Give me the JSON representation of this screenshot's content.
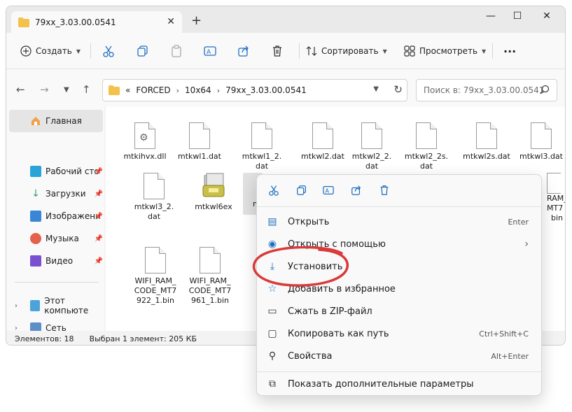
{
  "window": {
    "tab_title": "79xx_3.03.00.0541",
    "tab_close_glyph": "✕",
    "tab_add_glyph": "+",
    "minimize_glyph": "—",
    "maximize_glyph": "☐",
    "close_glyph": "✕"
  },
  "toolbar": {
    "create_label": "Создать",
    "sort_label": "Сортировать",
    "view_label": "Просмотреть",
    "more_glyph": "···"
  },
  "address": {
    "crumbs": [
      "FORCED",
      "10x64",
      "79xx_3.03.00.0541"
    ],
    "overflow_glyph": "«",
    "search_placeholder": "Поиск в: 79xx_3.03.00.0541"
  },
  "sidebar": {
    "items": [
      {
        "label": "Главная",
        "icon": "home-icon"
      },
      {
        "label": "Рабочий сто",
        "icon": "desktop-icon"
      },
      {
        "label": "Загрузки",
        "icon": "download-icon"
      },
      {
        "label": "Изображени",
        "icon": "pictures-icon"
      },
      {
        "label": "Музыка",
        "icon": "music-icon"
      },
      {
        "label": "Видео",
        "icon": "video-icon"
      },
      {
        "label": "Этот компьюте",
        "icon": "computer-icon"
      },
      {
        "label": "Сеть",
        "icon": "network-icon"
      }
    ]
  },
  "files": [
    {
      "name": "mtkihvx.dll",
      "icon": "dll-icon"
    },
    {
      "name": "mtkwl1.dat",
      "icon": "file-icon"
    },
    {
      "name": "mtkwl1_2.dat",
      "icon": "file-icon"
    },
    {
      "name": "mtkwl2.dat",
      "icon": "file-icon"
    },
    {
      "name": "mtkwl2_2.dat",
      "icon": "file-icon"
    },
    {
      "name": "mtkwl2_2s.dat",
      "icon": "file-icon"
    },
    {
      "name": "mtkwl2s.dat",
      "icon": "file-icon"
    },
    {
      "name": "mtkwl3.dat",
      "icon": "file-icon"
    },
    {
      "name": "mtkwl3_2.dat",
      "icon": "file-icon"
    },
    {
      "name": "mtkwl6ex",
      "icon": "installer-icon"
    },
    {
      "name": "mt",
      "icon": "inf-icon"
    },
    {
      "name": "RAM_",
      "icon": "file-icon"
    },
    {
      "name": "MT7",
      "icon": "file-icon"
    },
    {
      "name": "bin",
      "icon": "file-icon"
    },
    {
      "name": "WIFI_RAM_CODE_MT7922_1.bin",
      "icon": "file-icon"
    },
    {
      "name": "WIFI_RAM_CODE_MT7961_1.bin",
      "icon": "file-icon"
    }
  ],
  "status": {
    "count": "Элементов: 18",
    "selection": "Выбран 1 элемент: 205 КБ"
  },
  "context_menu": {
    "items": [
      {
        "label": "Открыть",
        "shortcut": "Enter",
        "icon": "open-icon"
      },
      {
        "label": "Открыть с помощью",
        "shortcut": "",
        "icon": "open-with-icon"
      },
      {
        "label": "Установить",
        "shortcut": "",
        "icon": "install-icon"
      },
      {
        "label": "Добавить в избранное",
        "shortcut": "",
        "icon": "star-icon"
      },
      {
        "label": "Сжать в ZIP-файл",
        "shortcut": "",
        "icon": "zip-icon"
      },
      {
        "label": "Копировать как путь",
        "shortcut": "Ctrl+Shift+C",
        "icon": "copy-path-icon"
      },
      {
        "label": "Свойства",
        "shortcut": "Alt+Enter",
        "icon": "properties-icon"
      },
      {
        "label": "Показать дополнительные параметры",
        "shortcut": "",
        "icon": "more-options-icon"
      }
    ]
  },
  "colors": {
    "accent": "#1f6fbf",
    "annotation": "#d93a3a",
    "folder": "#f2c24a"
  }
}
